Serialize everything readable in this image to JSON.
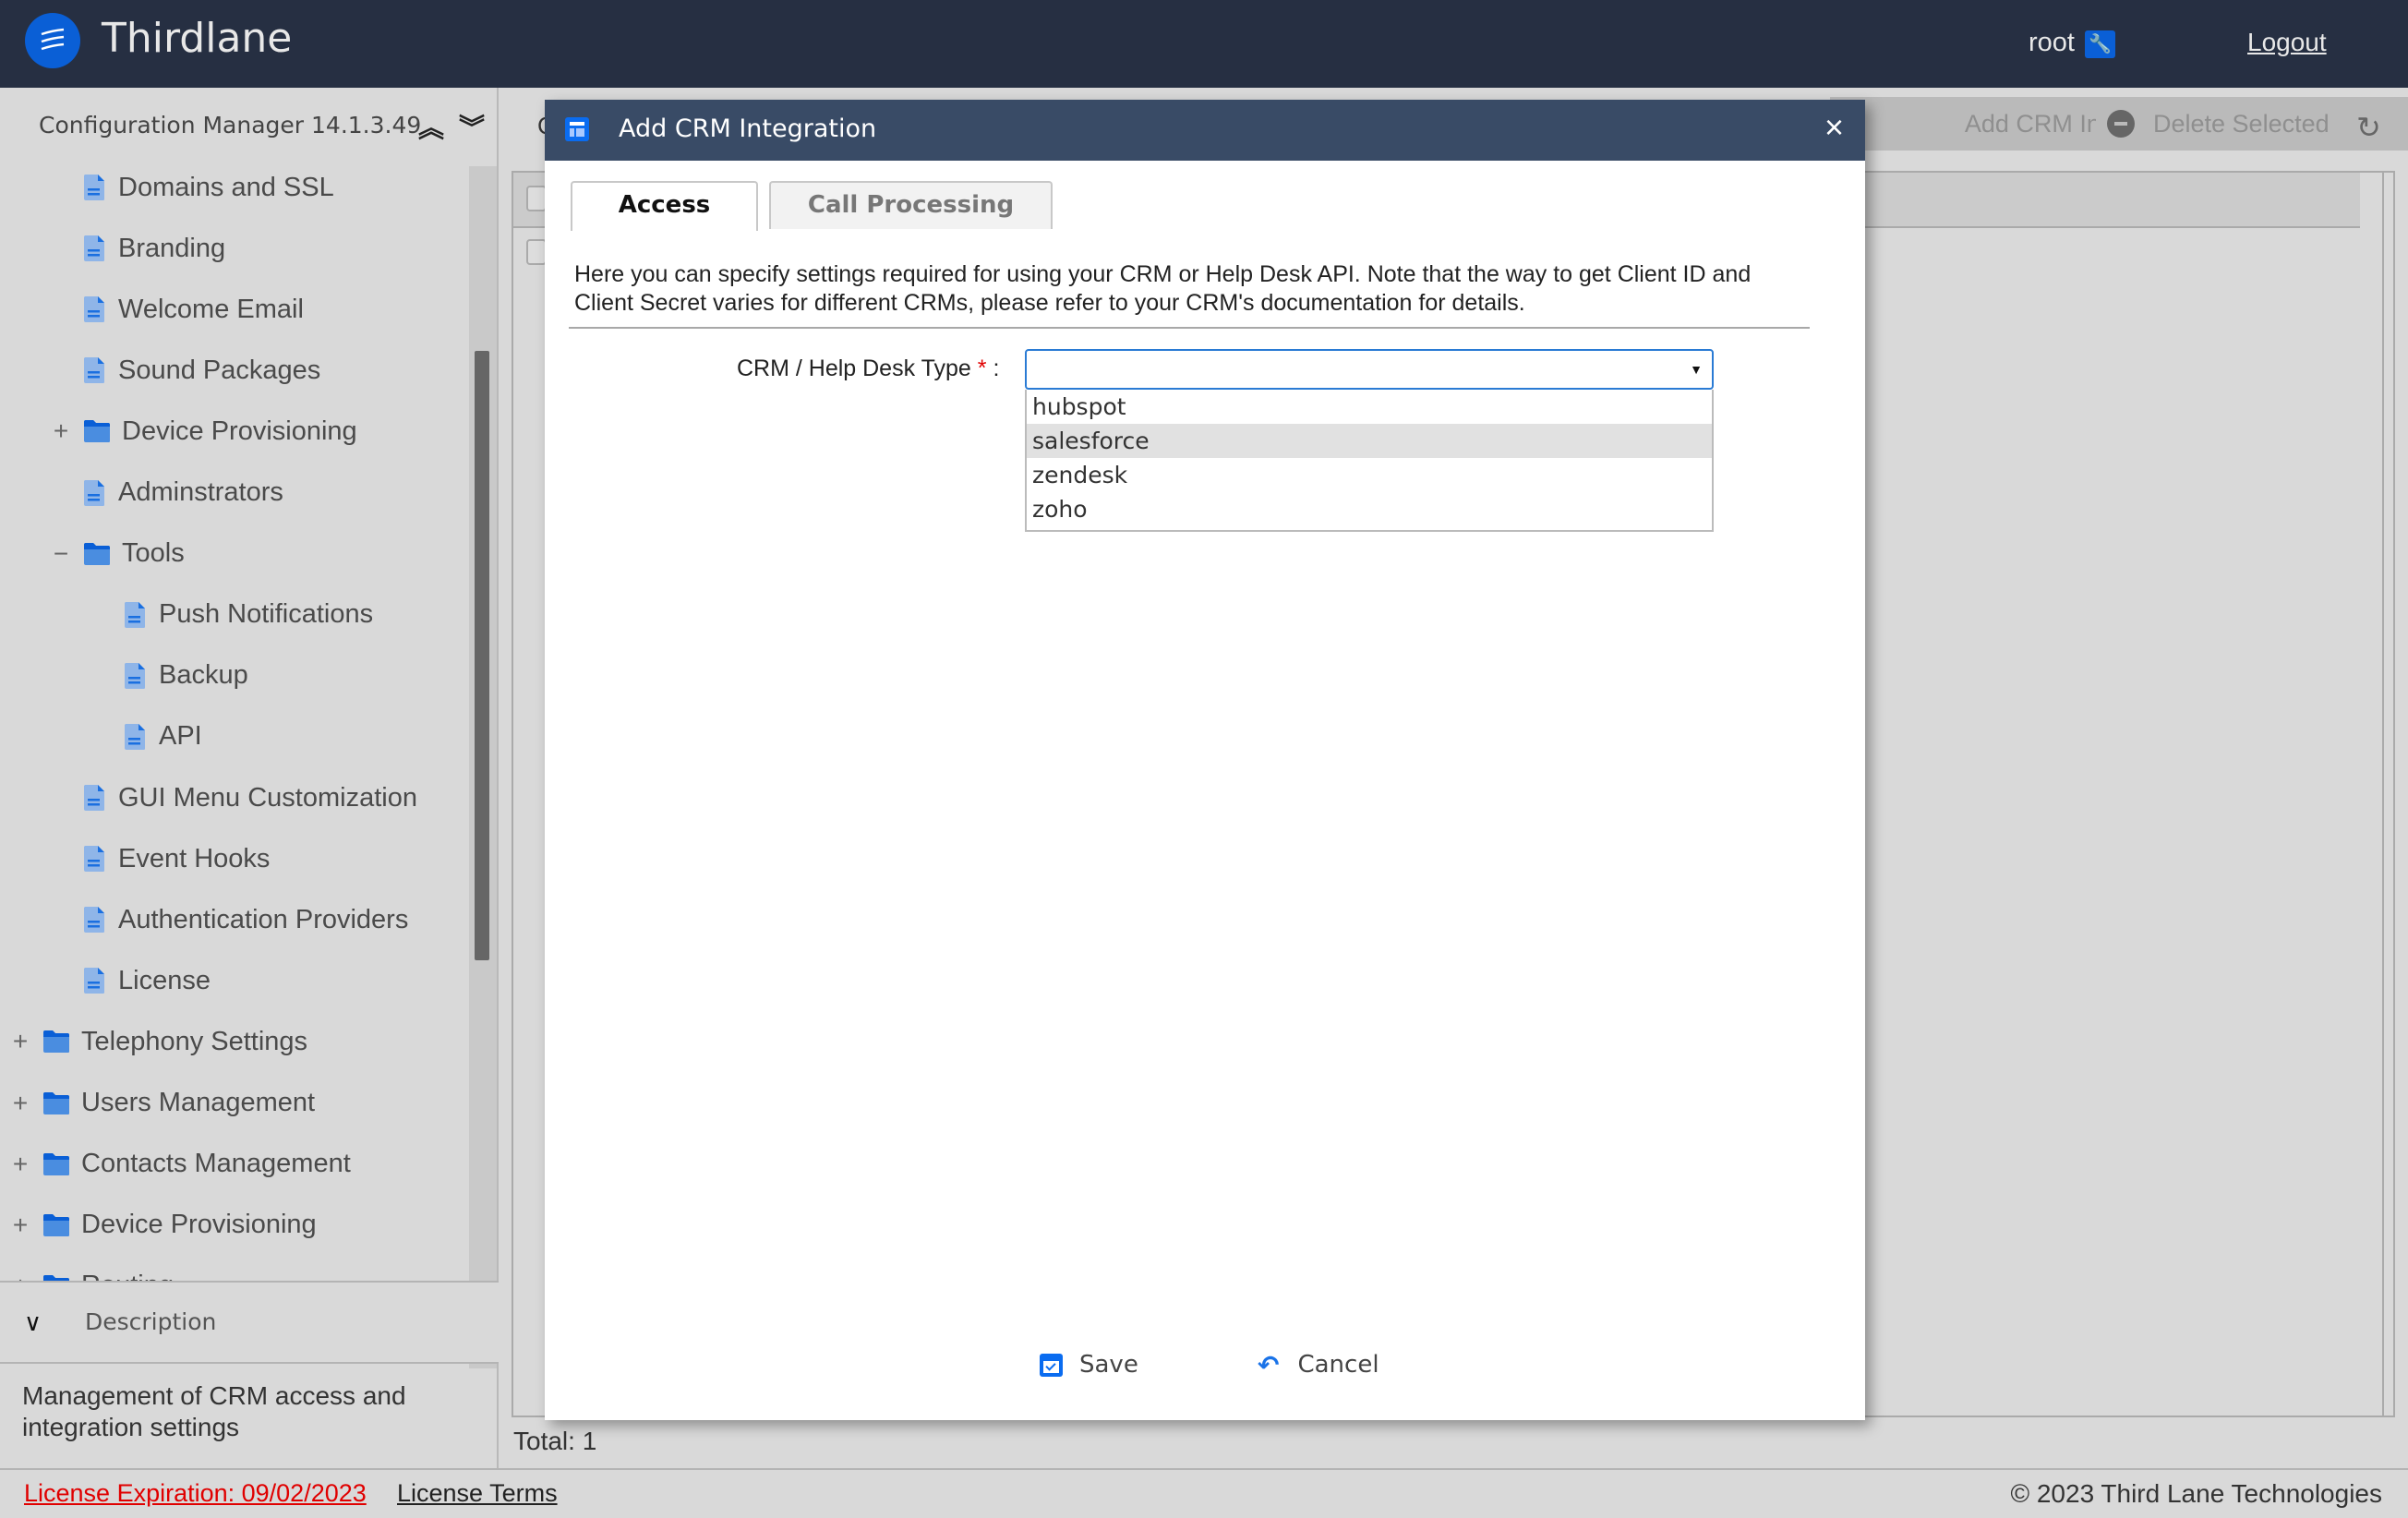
{
  "header": {
    "brand": "Thirdlane",
    "user": "root",
    "user_icon": "wrench-icon",
    "logout": "Logout"
  },
  "sidebar": {
    "title": "Configuration Manager 14.1.3.49",
    "collapse_all_icon": "double-chevron-up-icon",
    "expand_all_icon": "double-chevron-down-icon",
    "items": [
      {
        "label": "Domains and SSL",
        "type": "page",
        "level": 2
      },
      {
        "label": "Branding",
        "type": "page",
        "level": 2
      },
      {
        "label": "Welcome Email",
        "type": "page",
        "level": 2
      },
      {
        "label": "Sound Packages",
        "type": "page",
        "level": 2
      },
      {
        "label": "Device Provisioning",
        "type": "folder",
        "level": 2,
        "toggle": "+"
      },
      {
        "label": "Adminstrators",
        "type": "page",
        "level": 2
      },
      {
        "label": "Tools",
        "type": "folder",
        "level": 2,
        "toggle": "−"
      },
      {
        "label": "Push Notifications",
        "type": "page",
        "level": 3
      },
      {
        "label": "Backup",
        "type": "page",
        "level": 3
      },
      {
        "label": "API",
        "type": "page",
        "level": 3
      },
      {
        "label": "GUI Menu Customization",
        "type": "page",
        "level": 2
      },
      {
        "label": "Event Hooks",
        "type": "page",
        "level": 2
      },
      {
        "label": "Authentication Providers",
        "type": "page",
        "level": 2
      },
      {
        "label": "License",
        "type": "page",
        "level": 2
      },
      {
        "label": "Telephony Settings",
        "type": "folder",
        "level": 1,
        "toggle": "+"
      },
      {
        "label": "Users Management",
        "type": "folder",
        "level": 1,
        "toggle": "+"
      },
      {
        "label": "Contacts Management",
        "type": "folder",
        "level": 1,
        "toggle": "+"
      },
      {
        "label": "Device Provisioning",
        "type": "folder",
        "level": 1,
        "toggle": "+"
      },
      {
        "label": "Routing",
        "type": "folder",
        "level": 1,
        "toggle": "+"
      }
    ],
    "description_label": "Description",
    "description_text": "Management of CRM access and integration settings"
  },
  "main": {
    "title_partial": "C",
    "add_button": "Add CRM Integration",
    "delete_button": "Delete Selected",
    "refresh_icon": "refresh-icon",
    "total": "Total: 1"
  },
  "modal": {
    "title": "Add CRM Integration",
    "close": "×",
    "tabs": [
      {
        "label": "Access",
        "active": true
      },
      {
        "label": "Call Processing",
        "active": false
      }
    ],
    "info": "Here you can specify settings required for using your CRM or Help Desk API. Note that the way to get Client ID and Client Secret varies for different CRMs, please refer to your CRM's documentation for details.",
    "field_label": "CRM / Help Desk Type",
    "required_mark": "*",
    "field_colon": ":",
    "field_value": "",
    "options": [
      "hubspot",
      "salesforce",
      "zendesk",
      "zoho"
    ],
    "highlighted_option": "salesforce",
    "save": "Save",
    "cancel": "Cancel"
  },
  "footer": {
    "license_expiration": "License Expiration: 09/02/2023",
    "license_terms": "License Terms",
    "copyright": "© 2023 Third Lane Technologies"
  },
  "colors": {
    "header_bg": "#262f42",
    "modal_title_bg": "#394b66",
    "accent": "#0a6cf0",
    "danger": "#e00000"
  }
}
